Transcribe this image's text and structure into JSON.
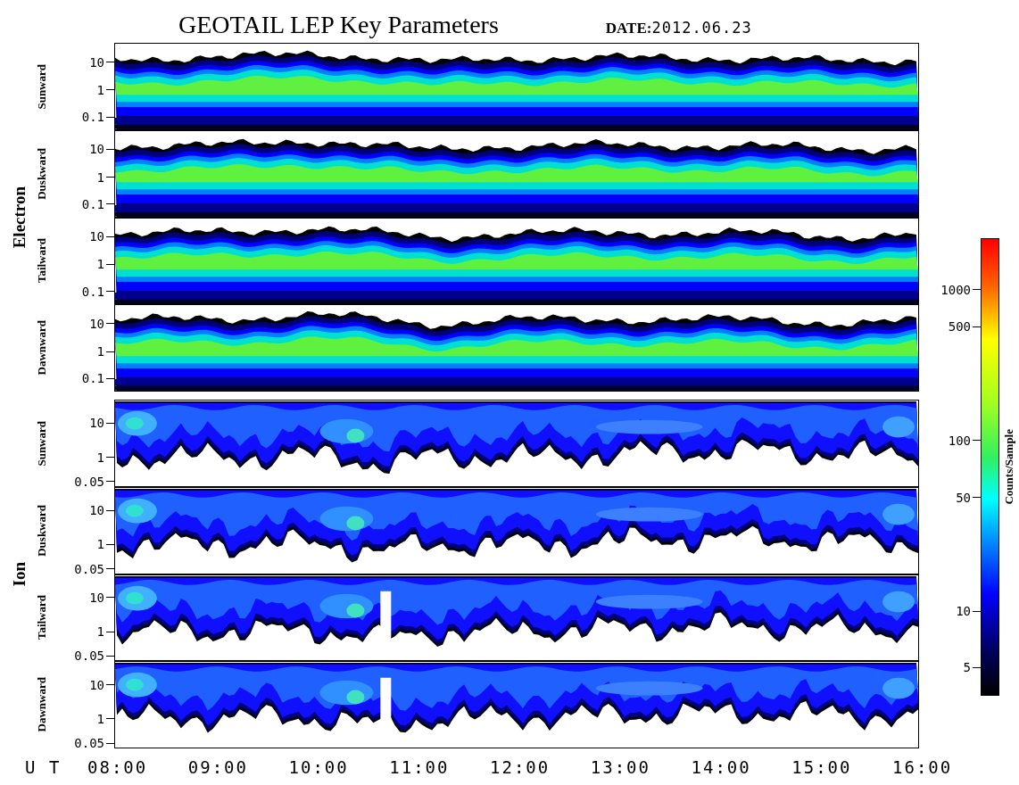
{
  "title": "GEOTAIL LEP Key Parameters",
  "date": {
    "label": "DATE:",
    "value": "2012.06.23"
  },
  "groups": [
    {
      "kind": "electron",
      "label": "Electron",
      "panels": [
        {
          "label": "Sunward",
          "yticks": [
            "10",
            "1",
            "0.1"
          ]
        },
        {
          "label": "Duskward",
          "yticks": [
            "10",
            "1",
            "0.1"
          ]
        },
        {
          "label": "Tailward",
          "yticks": [
            "10",
            "1",
            "0.1"
          ]
        },
        {
          "label": "Dawnward",
          "yticks": [
            "10",
            "1",
            "0.1"
          ]
        }
      ]
    },
    {
      "kind": "ion",
      "label": "Ion",
      "panels": [
        {
          "label": "Sunward",
          "yticks": [
            "10",
            "1",
            "0.05"
          ]
        },
        {
          "label": "Duskward",
          "yticks": [
            "10",
            "1",
            "0.05"
          ]
        },
        {
          "label": "Tailward",
          "yticks": [
            "10",
            "1",
            "0.05"
          ]
        },
        {
          "label": "Dawnward",
          "yticks": [
            "10",
            "1",
            "0.05"
          ]
        }
      ]
    }
  ],
  "x_axis": {
    "label": "U T",
    "ticks": [
      "08:00",
      "09:00",
      "10:00",
      "11:00",
      "12:00",
      "13:00",
      "14:00",
      "15:00",
      "16:00"
    ]
  },
  "colorbar": {
    "label": "Counts/Sample",
    "ticks": [
      "1000",
      "500",
      "100",
      "50",
      "10",
      "5"
    ]
  }
}
